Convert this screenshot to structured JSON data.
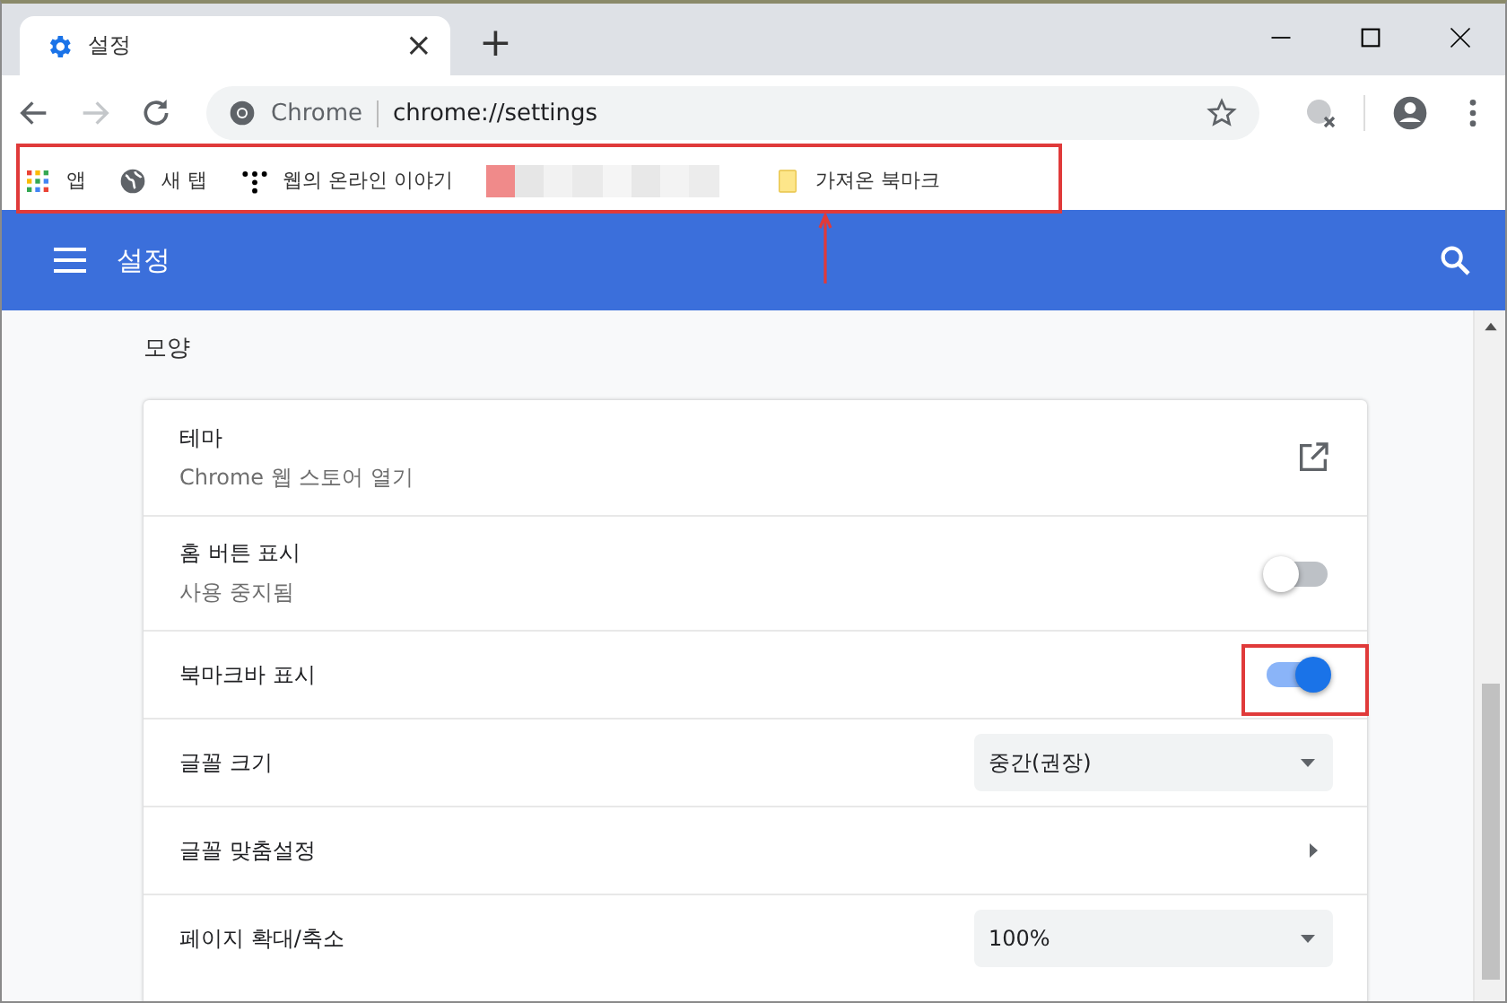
{
  "tabs": [
    {
      "title": "설정",
      "close": "×",
      "selected": true
    }
  ],
  "new_tab": "+",
  "address_bar": {
    "site_label": "Chrome",
    "url": "chrome://settings"
  },
  "bookmarks": [
    {
      "kind": "apps",
      "label": "앱"
    },
    {
      "kind": "globe",
      "label": "새 탭"
    },
    {
      "kind": "site",
      "label": "웹의 온라인 이야기"
    },
    {
      "kind": "blurred"
    },
    {
      "kind": "folder",
      "label": "가져온 북마크"
    }
  ],
  "header": {
    "title": "설정"
  },
  "section": {
    "title": "모양"
  },
  "settings": [
    {
      "kind": "link",
      "title": "테마",
      "subtitle": "Chrome 웹 스토어 열기"
    },
    {
      "kind": "toggle",
      "title": "홈 버튼 표시",
      "subtitle": "사용 중지됨",
      "on": false
    },
    {
      "kind": "toggle",
      "title": "북마크바 표시",
      "on": true
    },
    {
      "kind": "select",
      "title": "글꼴 크기",
      "value": "중간(권장)"
    },
    {
      "kind": "submenu",
      "title": "글꼴 맞춤설정"
    },
    {
      "kind": "select",
      "title": "페이지 확대/축소",
      "value": "100%"
    }
  ]
}
